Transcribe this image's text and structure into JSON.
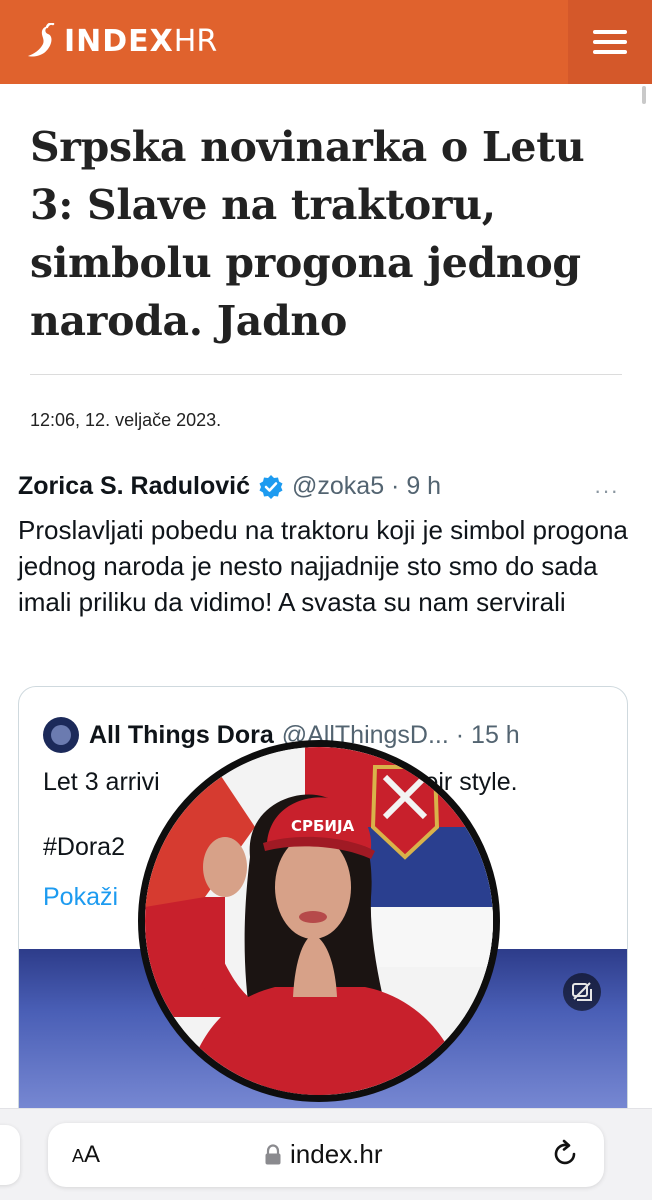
{
  "header": {
    "logo_index": "INDEX",
    "logo_hr": "HR",
    "menu_icon": "hamburger-menu-icon",
    "background_color": "#e0622d"
  },
  "article": {
    "headline": "Srpska novinarka o Letu 3: Slave na traktoru, simbolu progona jednog naroda. Jadno",
    "date": "12:06, 12. veljače 2023."
  },
  "tweet": {
    "author_name": "Zorica S. Radulović",
    "verified_icon": "verified-badge-icon",
    "handle_time": "@zoka5 · 9 h",
    "more": "···",
    "text": "Proslavljati pobedu na traktoru koji je simbol progona jednog naroda je nesto najjadnije sto smo do sada imali priliku da vidimo! A svasta su nam servirali",
    "quote": {
      "author_name": "All Things Dora",
      "handle_time": "@AllThingsD... · 15 h",
      "text_start": "Let 3 arrivi",
      "text_end": "their style.",
      "hashtag": "#Dora2",
      "show_more": "Pokaži"
    }
  },
  "portrait": {
    "cap_text": "СРБИЈА"
  },
  "browser": {
    "aa_label_small": "A",
    "aa_label_large": "A",
    "url": "index.hr",
    "lock_icon": "lock-icon",
    "reload_icon": "reload-icon"
  }
}
